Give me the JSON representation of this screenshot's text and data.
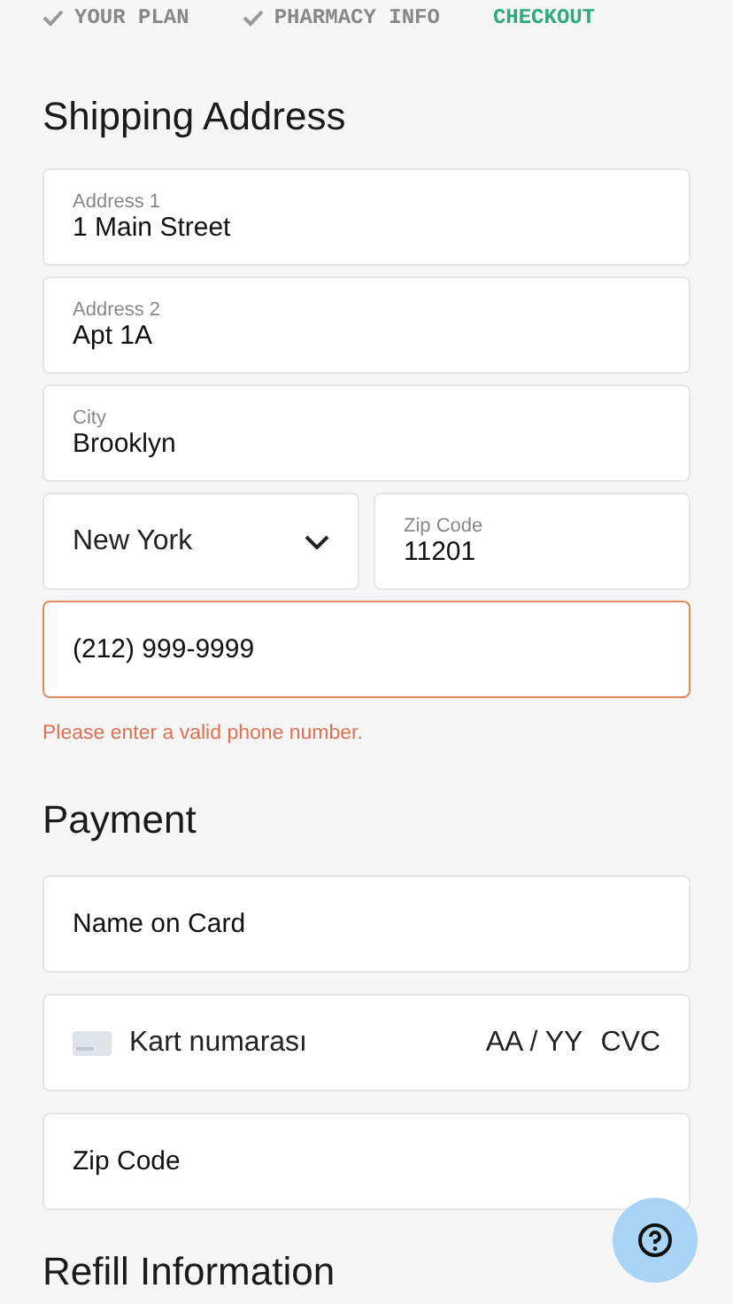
{
  "steps": [
    {
      "label": "YOUR PLAN",
      "completed": true,
      "selected": false
    },
    {
      "label": "PHARMACY INFO",
      "completed": true,
      "selected": false
    },
    {
      "label": "CHECKOUT",
      "completed": false,
      "selected": true
    }
  ],
  "shipping": {
    "title": "Shipping Address",
    "address1": {
      "label": "Address 1",
      "value": "1 Main Street"
    },
    "address2": {
      "label": "Address 2",
      "value": "Apt 1A"
    },
    "city": {
      "label": "City",
      "value": "Brooklyn"
    },
    "state": {
      "value": "New York"
    },
    "zip": {
      "label": "Zip Code",
      "value": "11201"
    },
    "phone": {
      "value": "(212) 999-9999",
      "invalid": true,
      "error": "Please enter a valid phone number."
    }
  },
  "payment": {
    "title": "Payment",
    "name": {
      "placeholder": "Name on Card"
    },
    "card": {
      "placeholder": "Kart numarası",
      "expiry": "AA / YY",
      "cvc": "CVC"
    },
    "zip": {
      "placeholder": "Zip Code"
    }
  },
  "next_section": {
    "title": "Refill Information"
  }
}
